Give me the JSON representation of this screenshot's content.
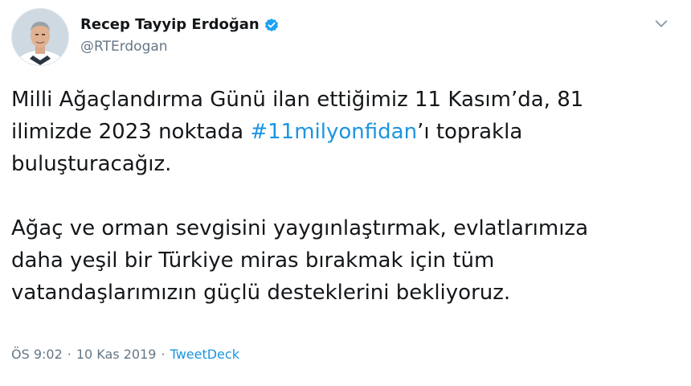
{
  "author": {
    "name": "Recep Tayyip Erdoğan",
    "handle": "@RTErdogan",
    "verified": true,
    "avatar_icon": "profile-photo"
  },
  "tweet": {
    "paragraph_1": {
      "line_1": "Milli Ağaçlandırma Günü ilan ettiğimiz 11 Kasım’da, 81",
      "line_2_before": "ilimizde 2023 noktada ",
      "hashtag": "#11milyonfidan",
      "line_2_after": "’ı toprakla",
      "line_3": "buluşturacağız."
    },
    "paragraph_2": {
      "line_1": "Ağaç ve orman sevgisini yaygınlaştırmak, evlatlarımıza",
      "line_2": "daha yeşil bir Türkiye miras bırakmak için tüm",
      "line_3": "vatandaşlarımızın güçlü desteklerini bekliyoruz."
    }
  },
  "meta": {
    "time": "ÖS 9:02",
    "separator": "·",
    "date": "10 Kas 2019",
    "source": "TweetDeck"
  },
  "icons": {
    "verified": "verified-badge-icon",
    "menu": "chevron-down-icon"
  },
  "colors": {
    "link": "#1b95e0",
    "text": "#14171a",
    "muted": "#657786",
    "verified": "#1da1f2"
  }
}
